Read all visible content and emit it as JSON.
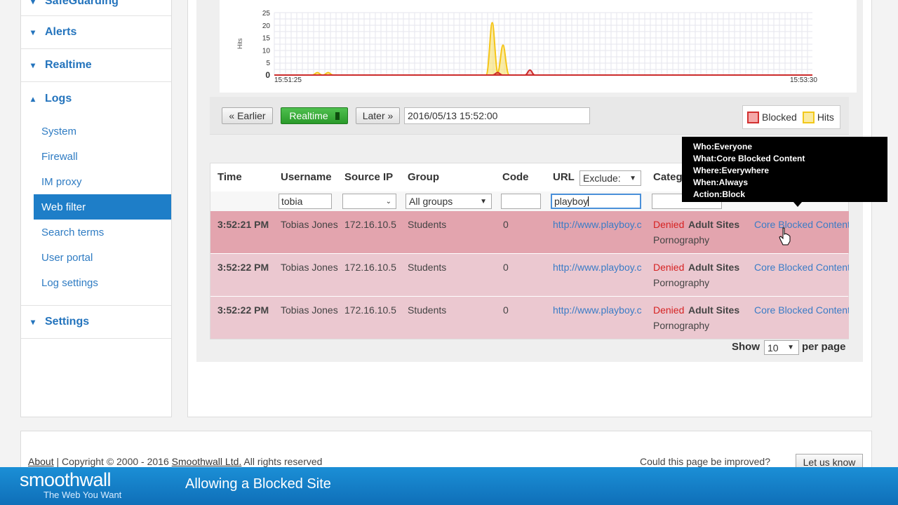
{
  "sidebar": {
    "top_item": "SafeGuarding",
    "alerts": "Alerts",
    "realtime": "Realtime",
    "logs": "Logs",
    "log_items": [
      "System",
      "Firewall",
      "IM proxy",
      "Web filter",
      "Search terms",
      "User portal",
      "Log settings"
    ],
    "settings": "Settings"
  },
  "chart": {
    "ylabel": "Hits",
    "x_start": "15:51:25",
    "x_end": "15:53:30",
    "y_ticks": [
      "25",
      "20",
      "15",
      "10",
      "5",
      "0"
    ]
  },
  "chart_data": {
    "type": "area",
    "x_range": [
      "15:51:25",
      "15:53:30"
    ],
    "ylim": [
      0,
      25
    ],
    "series": [
      {
        "name": "Blocked",
        "color": "#cc2b2b",
        "values": [
          0,
          0,
          0,
          0,
          0,
          0,
          0,
          0,
          0,
          0,
          0,
          0,
          0,
          0,
          0,
          0,
          0,
          0,
          0,
          0,
          0,
          0,
          0,
          0,
          0,
          0,
          0,
          0,
          0,
          0,
          0,
          0,
          0,
          0,
          0,
          0,
          0,
          0,
          0,
          0,
          0,
          0,
          0,
          0,
          0,
          0,
          0,
          0,
          0,
          0,
          0,
          0,
          0,
          0,
          0,
          0,
          0,
          0,
          0,
          0,
          0,
          0,
          0,
          0,
          0,
          0,
          0,
          0,
          0,
          0,
          0,
          0,
          0,
          0,
          0,
          0,
          0,
          0,
          0,
          0,
          0,
          0,
          0,
          0,
          0,
          0,
          0,
          0,
          0,
          0,
          0,
          0,
          0,
          0,
          0,
          0,
          0,
          0,
          0,
          0,
          0,
          0,
          0,
          0,
          0,
          0,
          0,
          0,
          0,
          0,
          0,
          0,
          0,
          0,
          0,
          0,
          0,
          0,
          0,
          0,
          0,
          0,
          0,
          0,
          0,
          0
        ]
      },
      {
        "name": "Hits",
        "color": "#f5c518",
        "values": [
          0,
          0,
          0,
          0,
          0,
          0,
          0,
          0,
          0,
          0,
          0,
          0,
          0,
          0,
          0,
          0,
          0,
          0,
          0,
          0,
          0,
          0,
          0,
          0,
          0,
          0,
          0,
          0,
          0,
          0,
          0,
          0,
          0,
          0,
          0,
          0,
          0,
          0,
          0,
          0,
          0,
          0,
          0,
          0,
          0,
          0,
          0,
          0,
          0,
          0,
          0,
          0,
          0,
          0,
          0,
          0,
          0,
          0,
          0,
          0,
          0,
          0,
          0,
          0,
          0,
          0,
          0,
          0,
          0,
          0,
          0,
          0,
          0,
          0,
          0,
          0,
          0,
          0,
          0,
          0,
          0,
          0,
          0,
          0,
          0,
          0,
          0,
          0,
          0,
          0,
          0,
          0,
          0,
          0,
          0,
          0,
          0,
          0,
          0,
          0,
          0,
          0,
          0,
          0,
          0,
          0,
          0,
          0,
          0,
          0,
          0,
          0,
          0,
          0,
          0,
          0,
          0,
          0,
          0,
          0,
          0,
          0,
          0,
          0,
          0,
          0
        ]
      }
    ],
    "peaks": [
      {
        "series": "Hits",
        "at_fraction": 0.08,
        "value": 1
      },
      {
        "series": "Hits",
        "at_fraction": 0.1,
        "value": 1
      },
      {
        "series": "Hits",
        "at_fraction": 0.405,
        "value": 21
      },
      {
        "series": "Hits",
        "at_fraction": 0.425,
        "value": 12
      },
      {
        "series": "Blocked",
        "at_fraction": 0.415,
        "value": 1
      },
      {
        "series": "Blocked",
        "at_fraction": 0.475,
        "value": 2
      }
    ]
  },
  "toolbar": {
    "earlier": "« Earlier",
    "realtime": "Realtime",
    "later": "Later »",
    "datetime": "2016/05/13 15:52:00"
  },
  "legend": {
    "blocked": "Blocked",
    "hits": "Hits",
    "blocked_color": "#e04444",
    "hits_color": "#f7df6b"
  },
  "table": {
    "headers": {
      "time": "Time",
      "username": "Username",
      "source_ip": "Source IP",
      "group": "Group",
      "code": "Code",
      "url": "URL",
      "category": "Categ"
    },
    "filters": {
      "username": "tobia",
      "group": "All groups",
      "url_mode": "Exclude:",
      "url": "playboy"
    },
    "rows": [
      {
        "time": "3:52:21 PM",
        "username": "Tobias Jones",
        "ip": "172.16.10.5",
        "group": "Students",
        "code": "0",
        "url": "http://www.playboy.c",
        "status": "Denied",
        "category": "Adult Sites",
        "subcategory": "Pornography",
        "policy": "Core Blocked Content"
      },
      {
        "time": "3:52:22 PM",
        "username": "Tobias Jones",
        "ip": "172.16.10.5",
        "group": "Students",
        "code": "0",
        "url": "http://www.playboy.c",
        "status": "Denied",
        "category": "Adult Sites",
        "subcategory": "Pornography",
        "policy": "Core Blocked Content"
      },
      {
        "time": "3:52:22 PM",
        "username": "Tobias Jones",
        "ip": "172.16.10.5",
        "group": "Students",
        "code": "0",
        "url": "http://www.playboy.c",
        "status": "Denied",
        "category": "Adult Sites",
        "subcategory": "Pornography",
        "policy": "Core Blocked Content"
      }
    ],
    "row_colors": [
      "#e3a4ae",
      "#ebc8d0",
      "#ebc8d0"
    ]
  },
  "tooltip": {
    "who": "Who:Everyone",
    "what": "What:Core Blocked Content",
    "where": "Where:Everywhere",
    "when": "When:Always",
    "action": "Action:Block"
  },
  "paging": {
    "show": "Show",
    "value": "10",
    "per_page": "per page"
  },
  "footer": {
    "about": "About",
    "sep": " | Copyright © 2000 - 2016 ",
    "company": "Smoothwall Ltd.",
    "rights": " All rights reserved",
    "improve": "Could this page be improved?",
    "letus": "Let us know"
  },
  "banner": {
    "brand": "smoothwall",
    "tagline": "The Web You Want",
    "title": "Allowing a Blocked Site"
  }
}
